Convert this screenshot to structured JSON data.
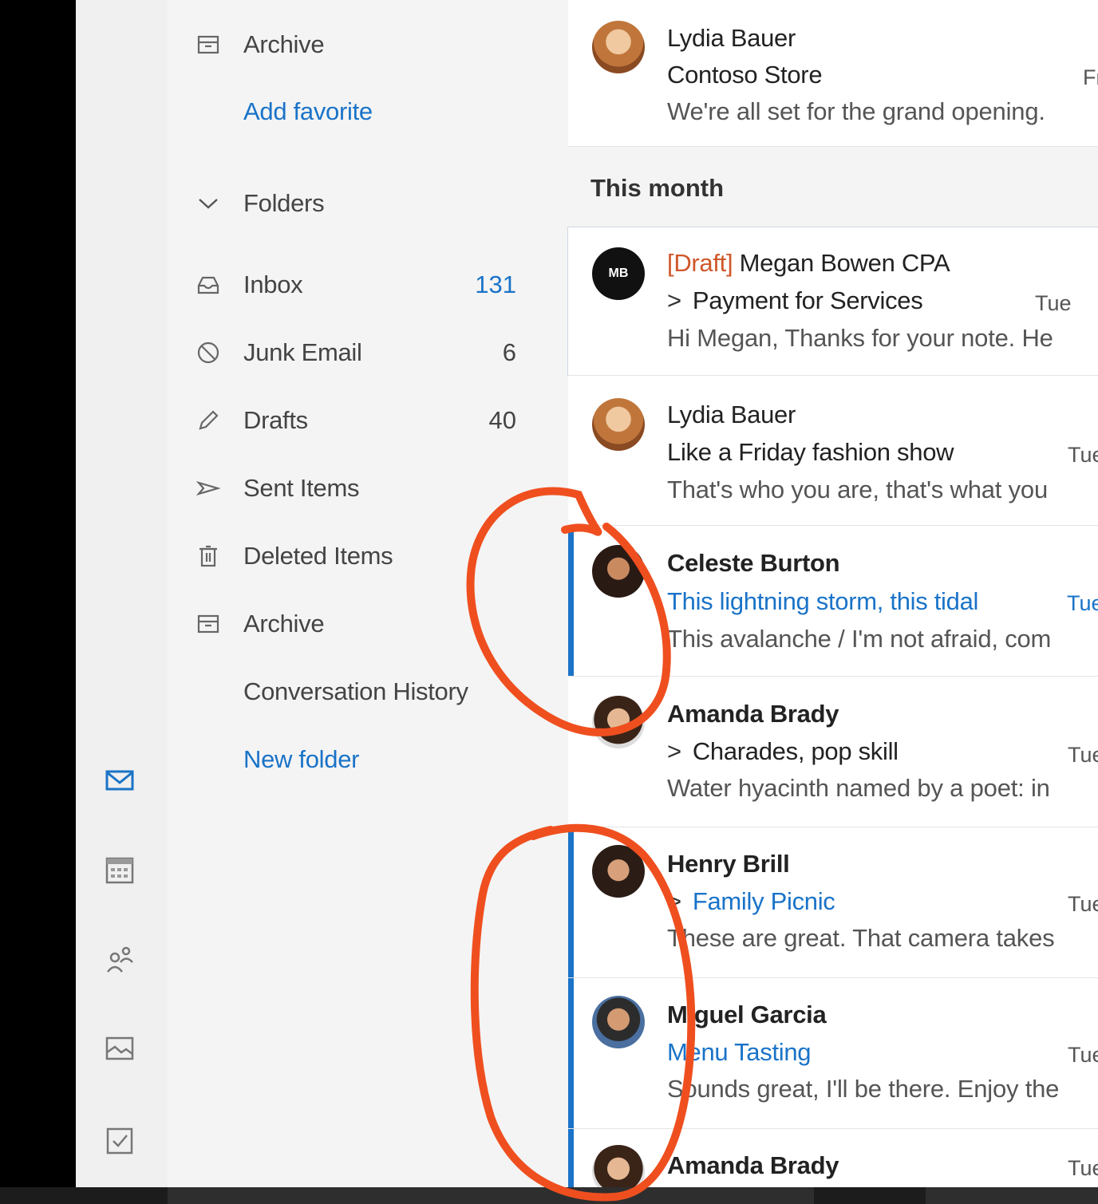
{
  "nav": {
    "favorites_archive": "Archive",
    "add_favorite": "Add favorite",
    "folders_header": "Folders",
    "folders": [
      {
        "label": "Inbox",
        "count": "131",
        "icon": "inbox-icon"
      },
      {
        "label": "Junk Email",
        "count": "6",
        "icon": "junk-icon"
      },
      {
        "label": "Drafts",
        "count": "40",
        "icon": "pencil-icon"
      },
      {
        "label": "Sent Items",
        "count": "",
        "icon": "send-icon"
      },
      {
        "label": "Deleted Items",
        "count": "",
        "icon": "trash-icon"
      },
      {
        "label": "Archive",
        "count": "",
        "icon": "archive-icon"
      },
      {
        "label": "Conversation History",
        "count": "",
        "icon": ""
      }
    ],
    "new_folder": "New folder"
  },
  "appbar": [
    "mail-icon",
    "calendar-icon",
    "people-icon",
    "photos-icon",
    "todo-icon"
  ],
  "list": {
    "section": "This month",
    "messages": [
      {
        "sender": "Lydia Bauer",
        "subject": "Contoso Store",
        "preview": "We're all set for the grand opening.",
        "date": "Fr"
      },
      {
        "draft_tag": "[Draft]",
        "sender": "Megan Bowen CPA",
        "initials": "MB",
        "subject": "Payment for Services",
        "preview": "Hi Megan, Thanks for your note.  He",
        "date": "Tue"
      },
      {
        "sender": "Lydia Bauer",
        "subject": "Like a Friday fashion show",
        "preview": "That's who you are, that's what you",
        "date": "Tue"
      },
      {
        "sender": "Celeste Burton",
        "subject": "This lightning storm, this tidal",
        "preview": "This avalanche / I'm not afraid, com",
        "date": "Tue"
      },
      {
        "sender": "Amanda Brady",
        "subject": "Charades, pop skill",
        "preview": "Water hyacinth named by a poet: in",
        "date": "Tue"
      },
      {
        "sender": "Henry Brill",
        "subject": "Family Picnic",
        "preview": "These are great. That camera takes",
        "date": "Tue"
      },
      {
        "sender": "Miguel Garcia",
        "subject": "Menu Tasting",
        "preview": "Sounds great, I'll be there. Enjoy the",
        "date": "Tue"
      },
      {
        "sender": "Amanda Brady",
        "subject": "",
        "preview": "",
        "date": "Tue"
      }
    ]
  },
  "colors": {
    "accent": "#1a73c8",
    "draft": "#d0572a",
    "annotation": "#ef4f1f"
  }
}
